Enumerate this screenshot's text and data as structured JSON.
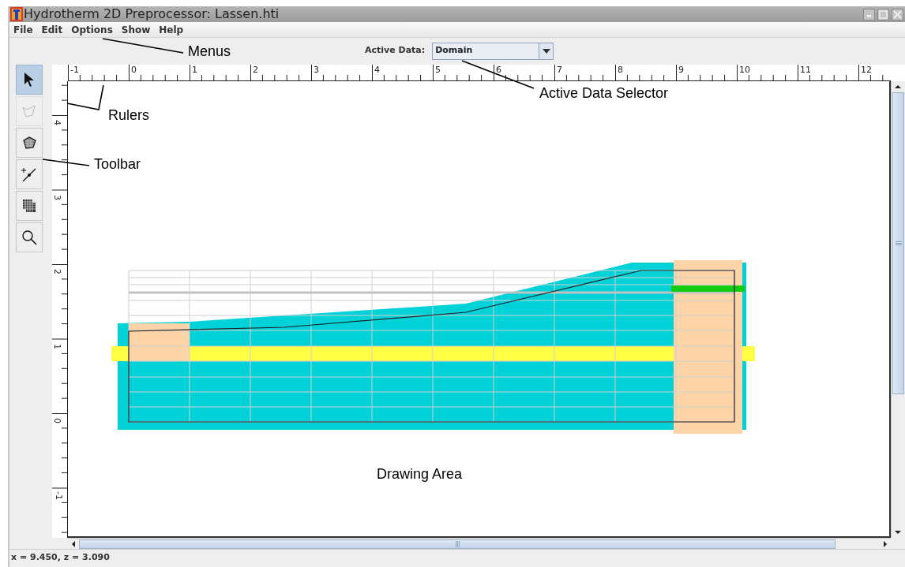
{
  "window": {
    "title": "Hydrotherm 2D Preprocessor: Lassen.hti"
  },
  "menu": [
    "File",
    "Edit",
    "Options",
    "Show",
    "Help"
  ],
  "active_data": {
    "label": "Active Data:",
    "value": "Domain"
  },
  "toolbar": [
    {
      "kind": "pointer",
      "selected": true,
      "disabled": false
    },
    {
      "kind": "outline",
      "selected": false,
      "disabled": true
    },
    {
      "kind": "polygon",
      "selected": false,
      "disabled": false
    },
    {
      "kind": "point",
      "selected": false,
      "disabled": false
    },
    {
      "kind": "grid",
      "selected": false,
      "disabled": false
    },
    {
      "kind": "zoom",
      "selected": false,
      "disabled": false
    }
  ],
  "rulers": {
    "horizontal": [
      "-1",
      "0",
      "1",
      "2",
      "3",
      "4",
      "5",
      "6",
      "7",
      "8",
      "9",
      "10",
      "11",
      "12"
    ],
    "vertical": [
      "4",
      "3",
      "2",
      "1",
      "0",
      "-1"
    ]
  },
  "annotations": [
    {
      "text": "Menus"
    },
    {
      "text": "Active Data Selector"
    },
    {
      "text": "Rulers"
    },
    {
      "text": "Toolbar"
    },
    {
      "text": "Drawing Area"
    }
  ],
  "status_bar": "x = 9.450, z = 3.090"
}
